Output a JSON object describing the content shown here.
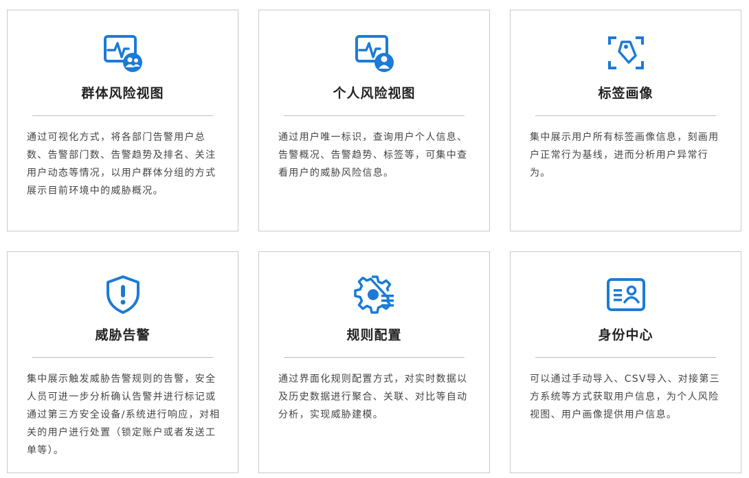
{
  "cards": [
    {
      "icon": "monitor-group-icon",
      "title": "群体风险视图",
      "desc": "通过可视化方式，将各部门告警用户总数、告警部门数、告警趋势及排名、关注用户动态等情况，以用户群体分组的方式展示目前环境中的威胁概况。"
    },
    {
      "icon": "monitor-user-icon",
      "title": "个人风险视图",
      "desc": "通过用户唯一标识，查询用户个人信息、告警概况、告警趋势、标签等，可集中查看用户的威胁风险信息。"
    },
    {
      "icon": "tag-scan-icon",
      "title": "标签画像",
      "desc": "集中展示用户所有标签画像信息，刻画用户正常行为基线，进而分析用户异常行为。"
    },
    {
      "icon": "shield-alert-icon",
      "title": "威胁告警",
      "desc": "集中展示触发威胁告警规则的告警，安全人员可进一步分析确认告警并进行标记或通过第三方安全设备/系统进行响应，对相关的用户进行处置（锁定账户或者发送工单等）。"
    },
    {
      "icon": "gear-list-icon",
      "title": "规则配置",
      "desc": "通过界面化规则配置方式，对实时数据以及历史数据进行聚合、关联、对比等自动分析，实现威胁建模。"
    },
    {
      "icon": "id-card-icon",
      "title": "身份中心",
      "desc": "可以通过手动导入、CSV导入、对接第三方系统等方式获取用户信息，为个人风险视图、用户画像提供用户信息。"
    }
  ],
  "colors": {
    "icon_blue": "#1b7bd6",
    "border": "#c9c9c9"
  }
}
